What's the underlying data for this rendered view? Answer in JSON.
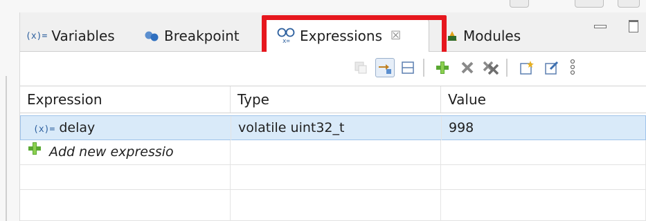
{
  "tabs": {
    "variables": {
      "icon_text": "(x)=",
      "label": "Variables"
    },
    "breakpoints": {
      "label": "Breakpoint"
    },
    "expressions": {
      "label": "Expressions",
      "close_glyph": "☒"
    },
    "modules": {
      "label": "Modules"
    }
  },
  "highlight_color": "#e6171e",
  "toolbar": [
    "show-logical-structure-icon",
    "collapse-all-icon",
    "layout-icon",
    "add-expression-icon",
    "remove-expression-icon",
    "remove-all-expressions-icon",
    "new-watch-icon",
    "edit-watch-icon",
    "view-menu-icon"
  ],
  "table": {
    "headers": {
      "expression": "Expression",
      "type": "Type",
      "value": "Value"
    },
    "rows": [
      {
        "prefix": "(x)=",
        "expression": "delay",
        "type": "volatile uint32_t",
        "value": "998"
      }
    ],
    "add_row_label": "Add new expressio"
  }
}
